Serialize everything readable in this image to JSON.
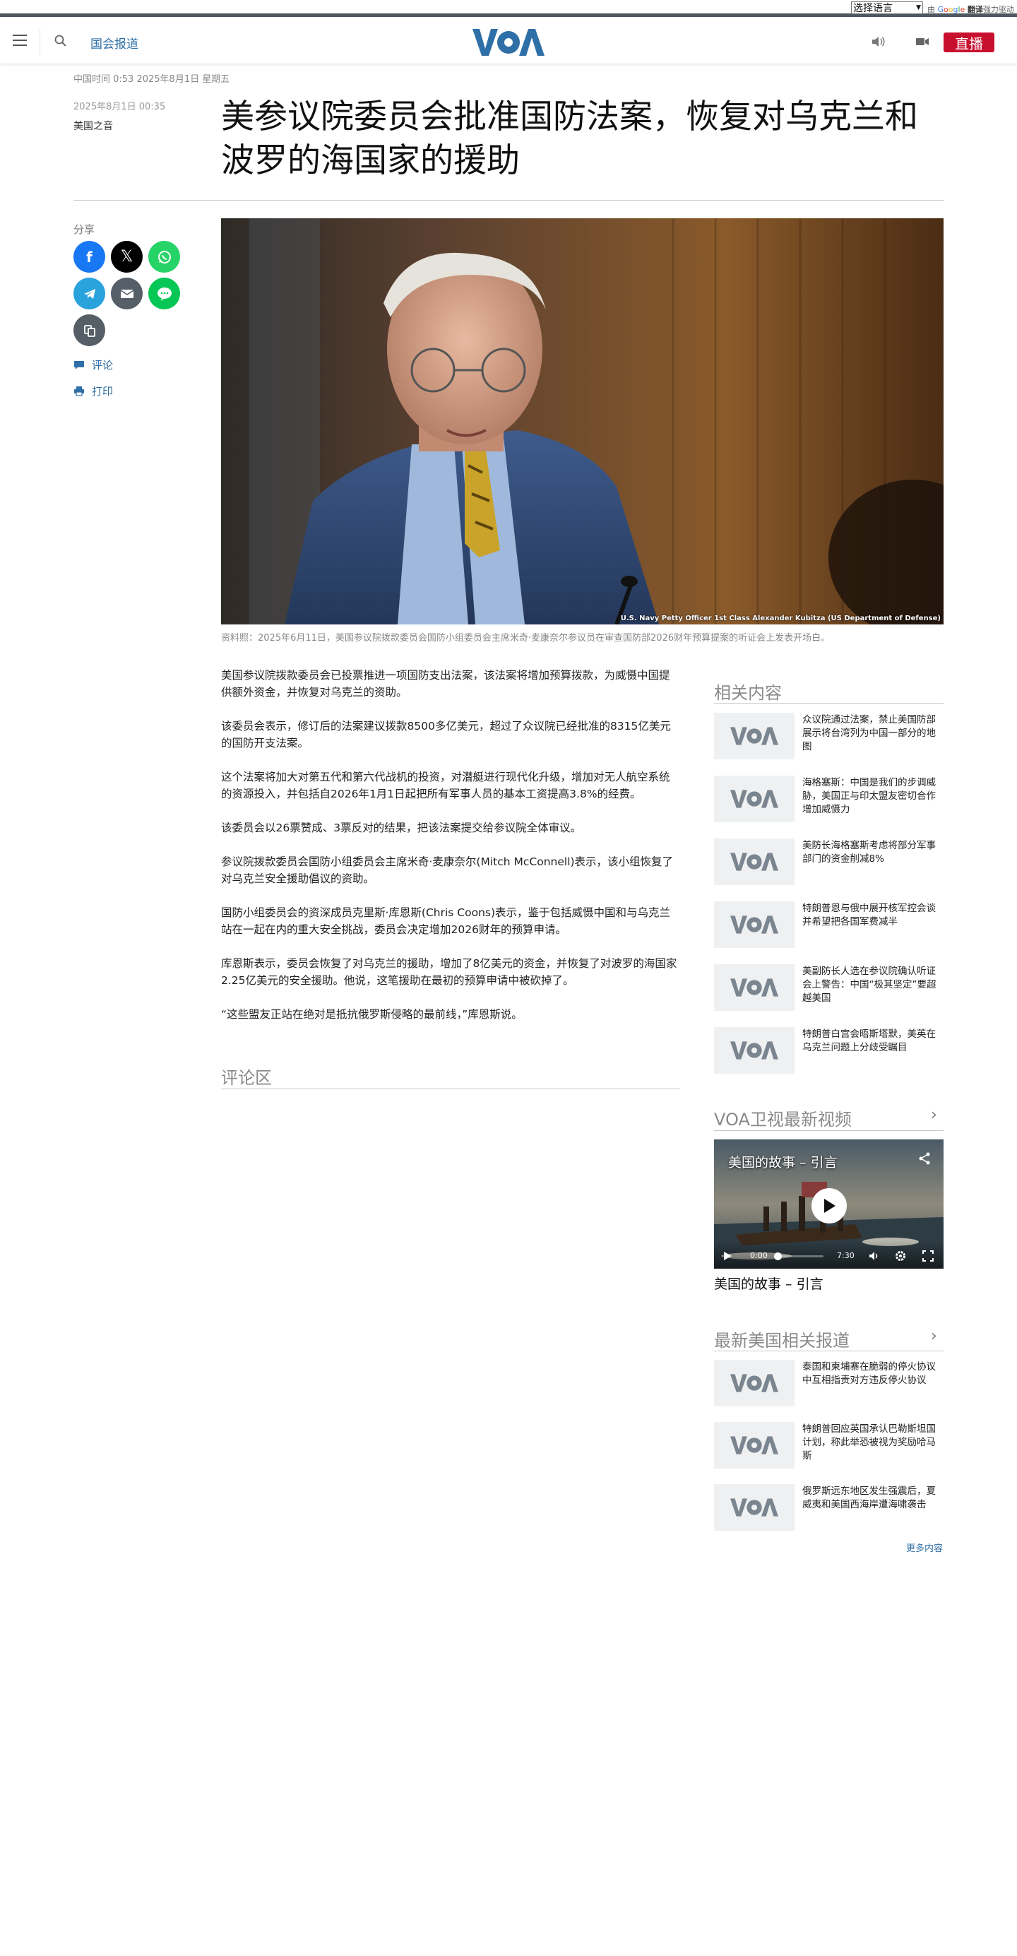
{
  "translate_bar": {
    "select_label": "选择语言",
    "powered_by_prefix": "由",
    "powered_by_brand_parts": [
      "G",
      "o",
      "o",
      "g",
      "l",
      "e"
    ],
    "translate_word": "翻译",
    "powered_by_suffix": "强力驱动"
  },
  "header": {
    "section": "国会报道",
    "logo_text": "VOA",
    "live_label": "直播"
  },
  "article": {
    "dateline": "中国时间 0:53 2025年8月1日 星期五",
    "published": "2025年8月1日 00:35",
    "author": "美国之音",
    "title": "美参议院委员会批准国防法案，恢复对乌克兰和波罗的海国家的援助",
    "share_label": "分享",
    "comment_label": "评论",
    "print_label": "打印",
    "image_credit": "U.S. Navy Petty Officer 1st Class Alexander Kubitza (US Department of Defense)",
    "caption": "资料照：2025年6月11日，美国参议院拨款委员会国防小组委员会主席米奇·麦康奈尔参议员在审查国防部2026财年预算提案的听证会上发表开场白。",
    "paragraphs": [
      "美国参议院拨款委员会已投票推进一项国防支出法案，该法案将增加预算拨款，为威慑中国提供额外资金，并恢复对乌克兰的资助。",
      "该委员会表示，修订后的法案建议拨款8500多亿美元，超过了众议院已经批准的8315亿美元的国防开支法案。",
      "这个法案将加大对第五代和第六代战机的投资，对潜艇进行现代化升级，增加对无人航空系统的资源投入，并包括自2026年1月1日起把所有军事人员的基本工资提高3.8%的经费。",
      "该委员会以26票赞成、3票反对的结果，把该法案提交给参议院全体审议。",
      "参议院拨款委员会国防小组委员会主席米奇·麦康奈尔(Mitch McConnell)表示，该小组恢复了对乌克兰安全援助倡议的资助。",
      "国防小组委员会的资深成员克里斯·库恩斯(Chris Coons)表示，鉴于包括威慑中国和与乌克兰站在一起在内的重大安全挑战，委员会决定增加2026财年的预算申请。",
      "库恩斯表示，委员会恢复了对乌克兰的援助，增加了8亿美元的资金，并恢复了对波罗的海国家2.25亿美元的安全援助。他说，这笔援助在最初的预算申请中被砍掉了。",
      "“这些盟友正站在绝对是抵抗俄罗斯侵略的最前线，”库恩斯说。"
    ],
    "comments_heading": "评论区"
  },
  "sidebar": {
    "related_heading": "相关内容",
    "related": [
      "众议院通过法案，禁止美国防部展示将台湾列为中国一部分的地图",
      "海格塞斯：中国是我们的步调威胁，美国正与印太盟友密切合作增加威慑力",
      "美防长海格塞斯考虑将部分军事部门的资金削减8%",
      "特朗普恩与俄中展开核军控会谈并希望把各国军费减半",
      "美副防长人选在参议院确认听证会上警告：中国“极其坚定”要超越美国",
      "特朗普白宫会晤斯塔默，美英在乌克兰问题上分歧受瞩目"
    ],
    "video_heading": "VOA卫视最新视频",
    "video": {
      "title": "美国的故事 – 引言",
      "time_current": "0:00",
      "time_total": "7:30",
      "progress": 0
    },
    "video_label": "美国的故事 – 引言",
    "latest_heading": "最新美国相关报道",
    "latest": [
      "泰国和柬埔寨在脆弱的停火协议中互相指责对方违反停火协议",
      "特朗普回应英国承认巴勒斯坦国计划，称此举恐被视为奖励哈马斯",
      "俄罗斯远东地区发生强震后，夏威夷和美国西海岸遭海啸袭击"
    ],
    "more_label": "更多内容"
  },
  "colors": {
    "accent": "#2f6fa7",
    "live": "#c8102e",
    "logo": "#2f6fa7"
  }
}
